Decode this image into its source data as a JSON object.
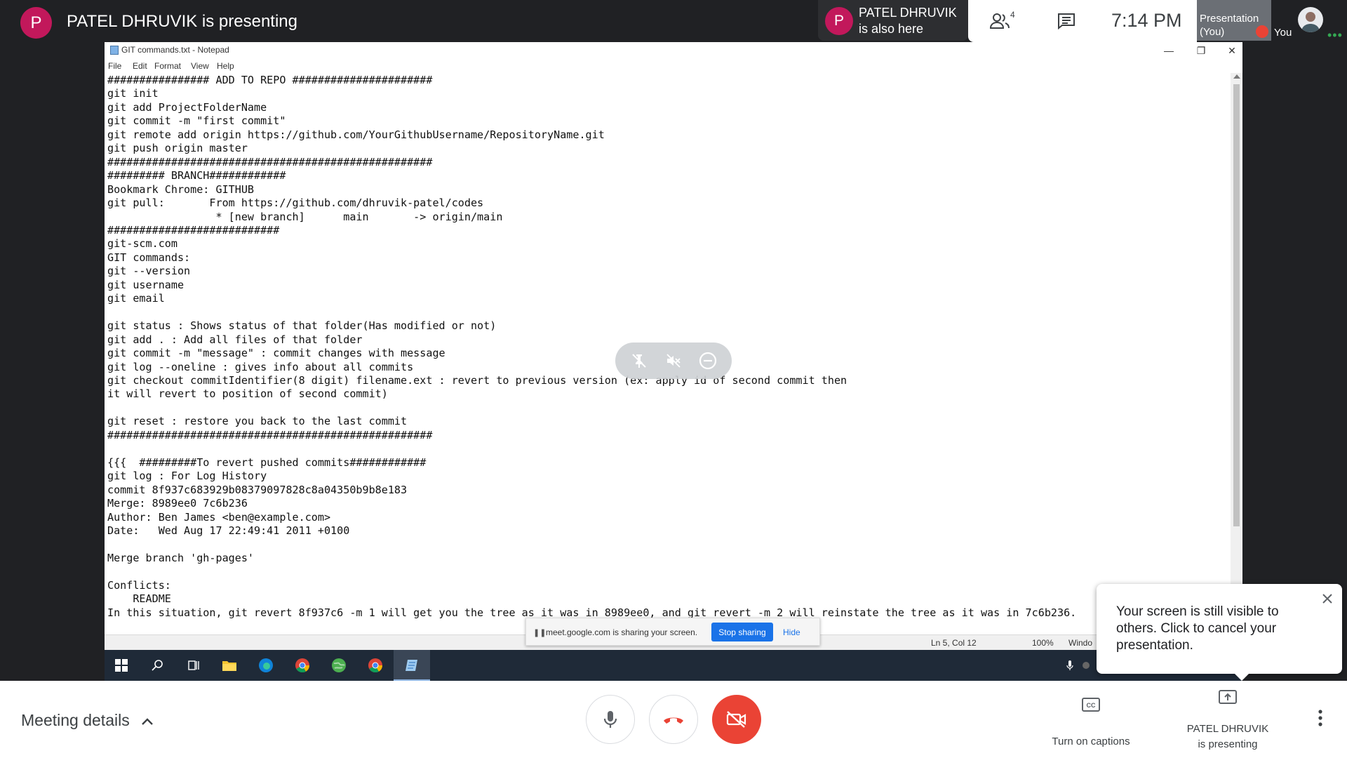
{
  "presenter": {
    "avatar_initial": "P",
    "title": "PATEL DHRUVIK is presenting"
  },
  "also_here": {
    "avatar_initial": "P",
    "line1": "PATEL DHRUVIK",
    "line2": "is also here"
  },
  "top_actions": {
    "people_count": "4",
    "time": "7:14 PM"
  },
  "self_tile": {
    "line1": "Presentation",
    "line2": "(You)",
    "you_label": "You"
  },
  "notepad": {
    "title": "GIT commands.txt - Notepad",
    "menu": [
      "File",
      "Edit",
      "Format",
      "View",
      "Help"
    ],
    "text": "################ ADD TO REPO ######################\ngit init\ngit add ProjectFolderName\ngit commit -m \"first commit\"\ngit remote add origin https://github.com/YourGithubUsername/RepositoryName.git\ngit push origin master\n###################################################\n######### BRANCH############\nBookmark Chrome: GITHUB\ngit pull:       From https://github.com/dhruvik-patel/codes\n                 * [new branch]      main       -> origin/main\n###########################\ngit-scm.com\nGIT commands:\ngit --version\ngit username\ngit email\n\ngit status : Shows status of that folder(Has modified or not)\ngit add . : Add all files of that folder\ngit commit -m \"message\" : commit changes with message\ngit log --oneline : gives info about all commits\ngit checkout commitIdentifier(8 digit) filename.ext : revert to previous version (ex: apply id of second commit then\nit will revert to position of second commit)\n\ngit reset : restore you back to the last commit\n###################################################\n\n{{{  #########To revert pushed commits############\ngit log : For Log History\ncommit 8f937c683929b08379097828c8a04350b9b8e183\nMerge: 8989ee0 7c6b236\nAuthor: Ben James <ben@example.com>\nDate:   Wed Aug 17 22:49:41 2011 +0100\n\nMerge branch 'gh-pages'\n\nConflicts:\n    README\nIn this situation, git revert 8f937c6 -m 1 will get you the tree as it was in 8989ee0, and git revert -m 2 will reinstate the tree as it was in 7c6b236.",
    "status_pos": "Ln 5, Col 12",
    "status_zoom": "100%",
    "status_eol": "Windo"
  },
  "share_notice": {
    "text": "meet.google.com is sharing your screen.",
    "stop_label": "Stop sharing",
    "hide_label": "Hide"
  },
  "toast": {
    "message": "Your screen is still visible to others. Click to cancel your presentation."
  },
  "bottom": {
    "meeting_details": "Meeting details",
    "captions_label": "Turn on captions",
    "presenting_line1": "PATEL DHRUVIK",
    "presenting_line2": "is presenting"
  },
  "colors": {
    "background": "#202124",
    "accent_red": "#ea4335",
    "avatar": "#c2185b",
    "stop_blue": "#1a73e8"
  }
}
